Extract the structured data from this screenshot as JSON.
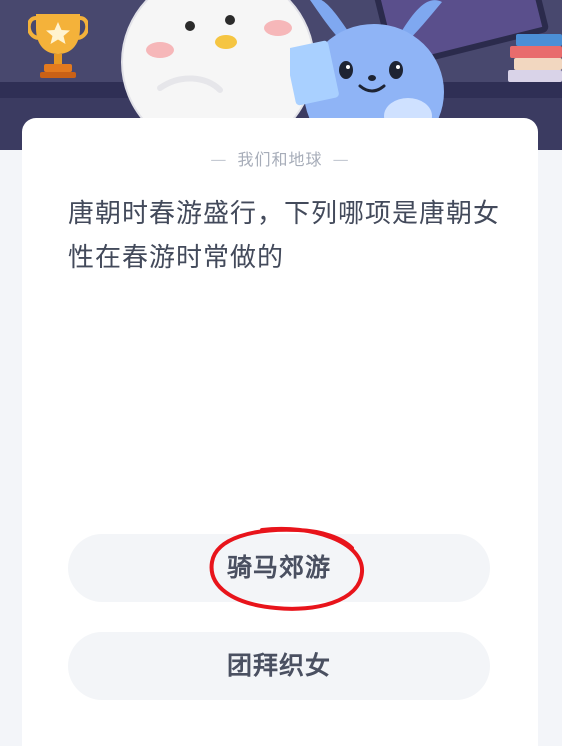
{
  "quiz": {
    "category": "我们和地球",
    "question": "唐朝时春游盛行，下列哪项是唐朝女性在春游时常做的",
    "options": [
      {
        "label": "骑马郊游",
        "annotated": true
      },
      {
        "label": "团拜织女",
        "annotated": false
      }
    ]
  },
  "colors": {
    "banner_background": "#48486e",
    "card_background": "#ffffff",
    "question_text": "#434a5b",
    "option_background": "#f3f5f8",
    "annotation_circle": "#e8141b"
  },
  "icons": {
    "trophy": "trophy-icon",
    "books": "books-icon",
    "mascot_white": "white-mascot-illustration",
    "mascot_blue": "blue-mascot-illustration"
  }
}
